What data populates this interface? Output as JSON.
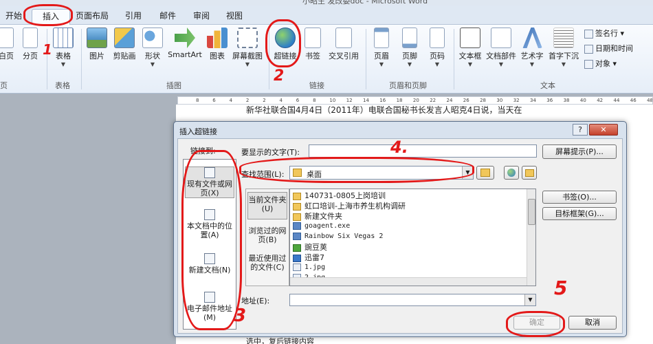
{
  "window": {
    "title_partial": "小昭生 发改委doc - Microsoft Word"
  },
  "tabs": [
    {
      "label": "开始"
    },
    {
      "label": "插入"
    },
    {
      "label": "页面布局"
    },
    {
      "label": "引用"
    },
    {
      "label": "邮件"
    },
    {
      "label": "审阅"
    },
    {
      "label": "视图"
    }
  ],
  "ribbon": {
    "buttons": {
      "blank_page": "白页",
      "page_break": "分页",
      "table": "表格",
      "picture": "图片",
      "clipart": "剪贴画",
      "shapes": "形状",
      "smartart": "SmartArt",
      "chart": "图表",
      "screenshot": "屏幕截图",
      "hyperlink": "超链接",
      "bookmark": "书签",
      "cross_ref": "交叉引用",
      "header": "页眉",
      "footer": "页脚",
      "page_number": "页码",
      "textbox": "文本框",
      "quickparts": "文档部件",
      "wordart": "艺术字",
      "dropcap": "首字下沉"
    },
    "small": {
      "signature": "签名行",
      "datetime": "日期和时间",
      "object": "对象"
    },
    "groups": {
      "pages": "页",
      "tables": "表格",
      "illustrations": "插图",
      "links": "链接",
      "header_footer": "页眉和页脚",
      "text": "文本"
    }
  },
  "ruler": [
    "8",
    "6",
    "4",
    "2",
    "2",
    "4",
    "6",
    "8",
    "10",
    "12",
    "14",
    "16",
    "18",
    "20",
    "22",
    "24",
    "26",
    "28",
    "30",
    "32",
    "34",
    "36",
    "38",
    "40",
    "42",
    "44",
    "46",
    "48"
  ],
  "document": {
    "line1": "新华社联合国4月4日（2011年）电联合国秘书长发言人昭克4日说，当天在",
    "line2": "选中，复后链接内容"
  },
  "dialog": {
    "title": "插入超链接",
    "help": "?",
    "close": "✕",
    "link_to_label": "链接到:",
    "display_text_label": "要显示的文字(T):",
    "display_text_value": "",
    "screentip_button": "屏幕提示(P)...",
    "lookin_label": "查找范围(L):",
    "lookin_value": "桌面",
    "link_to_items": [
      {
        "label": "现有文件或网页(X)"
      },
      {
        "label": "本文档中的位置(A)"
      },
      {
        "label": "新建文档(N)"
      },
      {
        "label": "电子邮件地址(M)"
      }
    ],
    "side_items": [
      {
        "label": "当前文件夹(U)"
      },
      {
        "label": "浏览过的网页(B)"
      },
      {
        "label": "最近使用过的文件(C)"
      }
    ],
    "files": [
      {
        "name": "140731-0805上岗培训",
        "kind": "folder"
      },
      {
        "name": "虹口培训-上海市养生机构调研",
        "kind": "folder"
      },
      {
        "name": "新建文件夹",
        "kind": "folder"
      },
      {
        "name": "goagent.exe",
        "kind": "exe"
      },
      {
        "name": "Rainbow Six Vegas 2",
        "kind": "exe"
      },
      {
        "name": "豌豆荚",
        "kind": "app"
      },
      {
        "name": "迅雷7",
        "kind": "app"
      },
      {
        "name": "1.jpg",
        "kind": "image"
      },
      {
        "name": "2.jpg",
        "kind": "image"
      }
    ],
    "bookmark_button": "书签(O)...",
    "target_frame_button": "目标框架(G)...",
    "address_label": "地址(E):",
    "address_value": "",
    "ok_button": "确定",
    "cancel_button": "取消"
  },
  "annotations": {
    "n1": "1",
    "n2": "2",
    "n3": "3",
    "n4": "4.",
    "n5": "5"
  },
  "colors": {
    "annotation": "#e31919",
    "ribbon_bg": "#e6eef8",
    "dialog_frame": "#d8e2ee"
  }
}
